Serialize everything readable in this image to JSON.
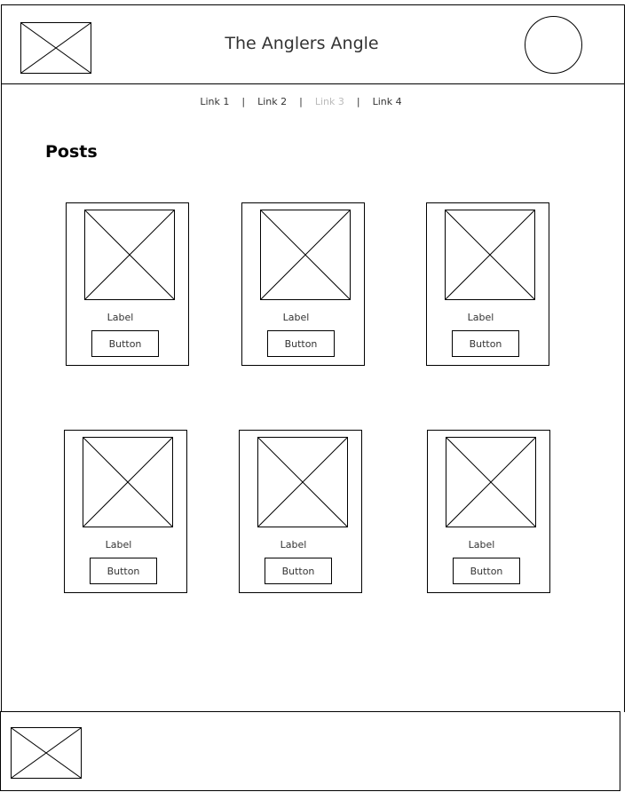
{
  "header": {
    "title": "The Anglers Angle",
    "logo_icon": "image-placeholder-icon",
    "avatar_icon": "circle-avatar-icon"
  },
  "nav": {
    "links": [
      {
        "label": "Link 1",
        "state": "normal"
      },
      {
        "label": "Link 2",
        "state": "normal"
      },
      {
        "label": "Link 3",
        "state": "disabled"
      },
      {
        "label": "Link 4",
        "state": "normal"
      }
    ],
    "separator": "|"
  },
  "posts": {
    "heading": "Posts",
    "cards": [
      {
        "label": "Label",
        "button": "Button"
      },
      {
        "label": "Label",
        "button": "Button"
      },
      {
        "label": "Label",
        "button": "Button"
      },
      {
        "label": "Label",
        "button": "Button"
      },
      {
        "label": "Label",
        "button": "Button"
      },
      {
        "label": "Label",
        "button": "Button"
      }
    ]
  },
  "footer": {
    "logo_icon": "image-placeholder-icon"
  },
  "colors": {
    "line": "#000000",
    "text": "#333333",
    "disabled_link": "#bbbbbb"
  }
}
